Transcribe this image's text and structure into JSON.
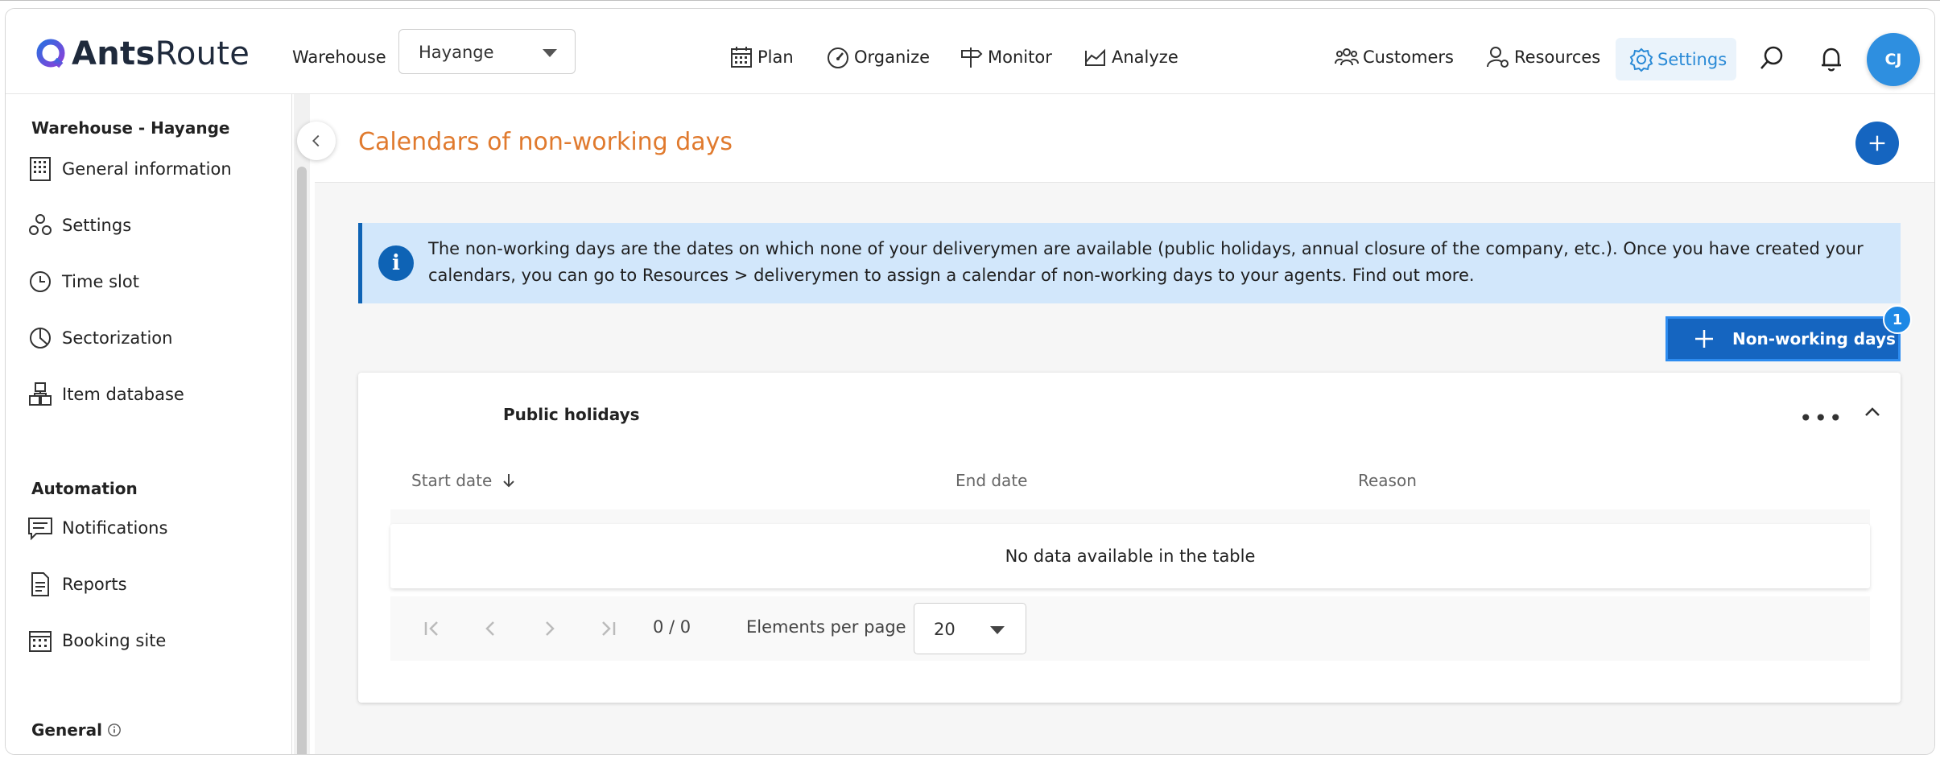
{
  "header": {
    "logo_bold": "Ants",
    "logo_light": "Route",
    "warehouse_label": "Warehouse",
    "warehouse_value": "Hayange",
    "nav": {
      "plan": "Plan",
      "organize": "Organize",
      "monitor": "Monitor",
      "analyze": "Analyze",
      "customers": "Customers",
      "resources": "Resources",
      "settings": "Settings"
    },
    "avatar_initials": "CJ"
  },
  "sidebar": {
    "section_warehouse": "Warehouse - Hayange",
    "items": [
      {
        "label": "General information",
        "icon": "building-icon"
      },
      {
        "label": "Settings",
        "icon": "gears-icon"
      },
      {
        "label": "Time slot",
        "icon": "clock-icon"
      },
      {
        "label": "Sectorization",
        "icon": "pie-chart-icon"
      },
      {
        "label": "Item database",
        "icon": "boxes-icon"
      }
    ],
    "section_automation": "Automation",
    "automation_items": [
      {
        "label": "Notifications",
        "icon": "chat-icon"
      },
      {
        "label": "Reports",
        "icon": "document-icon"
      },
      {
        "label": "Booking site",
        "icon": "calendar-icon"
      }
    ],
    "section_general": "General"
  },
  "main": {
    "title": "Calendars of non-working days",
    "info_text": "The non-working days are the dates on which none of your deliverymen are available (public holidays, annual closure of the company, etc.). Once you have created your calendars, you can go to Resources > deliverymen to assign a calendar of non-working days to your agents. Find out more.",
    "add_button_label": "Non-working days",
    "badge_count": "1",
    "card": {
      "title": "Public holidays",
      "columns": [
        "Start date",
        "End date",
        "Reason"
      ],
      "empty_message": "No data available in the table",
      "pagination": {
        "count": "0 / 0",
        "per_page_label": "Elements per page",
        "per_page_value": "20"
      }
    }
  },
  "colors": {
    "accent": "#2a8ad6",
    "primary": "#1565c0",
    "title": "#e07a2e",
    "info_bg": "#d2e7fb"
  }
}
